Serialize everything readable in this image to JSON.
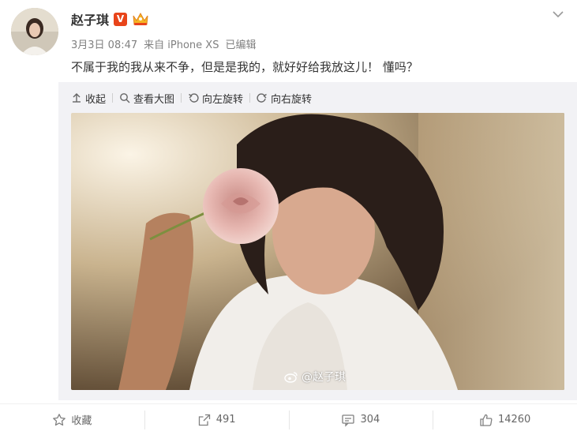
{
  "post": {
    "author": "赵子琪",
    "date": "3月3日 08:47",
    "source": "来自 iPhone XS",
    "edited": "已编辑",
    "text": "不属于我的我从来不争，但是是我的，就好好给我放这儿！ 懂吗？"
  },
  "badges": {
    "verified_letter": "V",
    "verified_icon": "verified-v-icon",
    "member_icon": "member-crown-icon"
  },
  "toolbar": {
    "collapse": "收起",
    "view_large": "查看大图",
    "rotate_left": "向左旋转",
    "rotate_right": "向右旋转"
  },
  "image": {
    "watermark": "@赵子琪"
  },
  "footer": {
    "favorite": "收藏",
    "repost_count": "491",
    "comment_count": "304",
    "like_count": "14260"
  },
  "colors": {
    "verified_badge": "#e8441a",
    "panel_bg": "#f2f2f5",
    "text": "#333333",
    "meta": "#808080"
  }
}
